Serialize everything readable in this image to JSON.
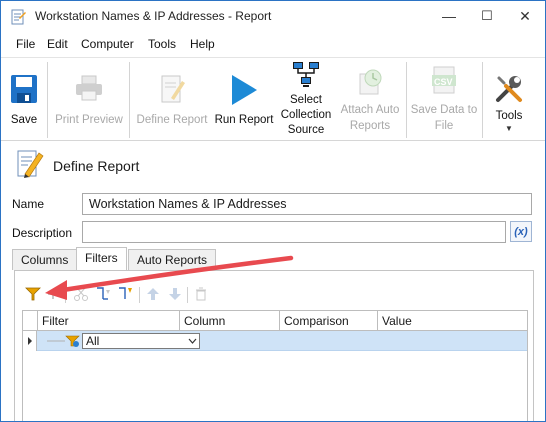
{
  "window": {
    "title": "Workstation Names & IP Addresses - Report",
    "controls": {
      "minimize": "—",
      "maximize": "☐",
      "close": "✕"
    }
  },
  "menu": [
    "File",
    "Edit",
    "Computer",
    "Tools",
    "Help"
  ],
  "toolbar": {
    "save": "Save",
    "print_preview": "Print Preview",
    "define_report": "Define Report",
    "run_report": "Run Report",
    "select_collection_source": [
      "Select",
      "Collection",
      "Source"
    ],
    "attach_auto_reports": [
      "Attach Auto",
      "Reports"
    ],
    "save_data_to_file": [
      "Save Data to",
      "File"
    ],
    "csv_badge": "CSV",
    "tools": "Tools"
  },
  "section": {
    "title": "Define Report"
  },
  "form": {
    "name_label": "Name",
    "name_value": "Workstation Names & IP Addresses",
    "description_label": "Description",
    "description_value": "",
    "expression_button": "(x)"
  },
  "tabs": [
    "Columns",
    "Filters",
    "Auto Reports"
  ],
  "active_tab": "Filters",
  "grid": {
    "columns": [
      "Filter",
      "Column",
      "Comparison",
      "Value"
    ],
    "rows": [
      {
        "filter": "All",
        "column": "",
        "comparison": "",
        "value": ""
      }
    ]
  },
  "colors": {
    "window_border": "#2b73c4",
    "run_arrow": "#1d8ad6",
    "selected_row": "#cfe3f7",
    "annotation_arrow": "#e84a4f",
    "filter_icon": "#e8a200"
  }
}
